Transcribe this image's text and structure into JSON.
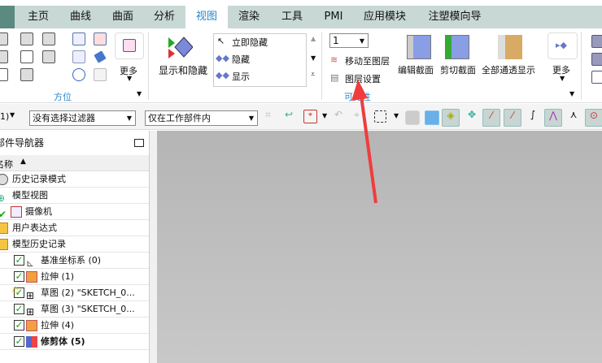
{
  "tabs": [
    "主页",
    "曲线",
    "曲面",
    "分析",
    "视图",
    "渲染",
    "工具",
    "PMI",
    "应用模块",
    "注塑模向导"
  ],
  "active_tab": "视图",
  "ribbon": {
    "orientation_group": "方位",
    "more_label": "更多",
    "show_hide_label": "显示和隐藏",
    "immediate_hide": "立即隐藏",
    "hide": "隐藏",
    "show": "显示",
    "layer_value": "1",
    "move_to_layer": "移动至图层",
    "layer_settings": "图层设置",
    "visibility_group": "可见性",
    "edit_section": "编辑截面",
    "clip_section": "剪切截面",
    "all_transparent": "全部通透显示",
    "more_label2": "更多"
  },
  "toolbar": {
    "filter": "没有选择过滤器",
    "scope": "仅在工作部件内",
    "left_fragment": "1)"
  },
  "navigator": {
    "title": "部件导航器",
    "column": "名称",
    "rows": [
      {
        "label": "历史记录模式",
        "icon": "clock-icon"
      },
      {
        "label": "模型视图",
        "icon": "model-view-icon"
      },
      {
        "label": "摄像机",
        "icon": "camera-icon"
      },
      {
        "label": "用户表达式",
        "icon": "folder-icon"
      },
      {
        "label": "模型历史记录",
        "icon": "folder-icon"
      },
      {
        "label": "基准坐标系 (0)",
        "icon": "datum-csys-icon"
      },
      {
        "label": "拉伸 (1)",
        "icon": "extrude-icon"
      },
      {
        "label": "草图 (2) \"SKETCH_0...",
        "icon": "sketch-icon"
      },
      {
        "label": "草图 (3) \"SKETCH_0...",
        "icon": "sketch-icon"
      },
      {
        "label": "拉伸 (4)",
        "icon": "extrude-icon"
      },
      {
        "label": "修剪体 (5)",
        "icon": "trim-body-icon"
      }
    ]
  },
  "colors": {
    "accent": "#2a86c8",
    "tabbar": "#c8d8d5",
    "arrow": "#f03c3c"
  }
}
